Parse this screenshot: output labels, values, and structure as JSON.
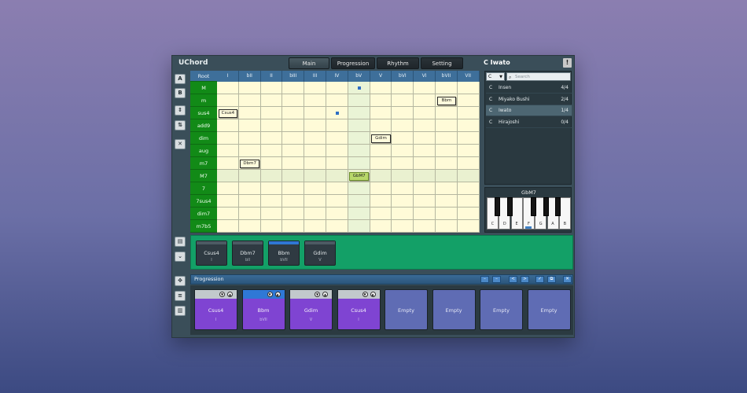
{
  "app": {
    "title": "UChord"
  },
  "tabs": [
    {
      "label": "Main",
      "active": true
    },
    {
      "label": "Progression",
      "active": false
    },
    {
      "label": "Rhythm",
      "active": false
    },
    {
      "label": "Setting",
      "active": false
    }
  ],
  "scale_title": "C Iwato",
  "alert_label": "!",
  "side_buttons": {
    "a": "A",
    "b": "B",
    "updown": "⇕",
    "sort": "⇅",
    "delete": "✕",
    "chart": "▤",
    "collapse": "⌄",
    "move": "✥",
    "list": "≡",
    "piano": "▥"
  },
  "grid": {
    "root_label": "Root",
    "columns": [
      "I",
      "bII",
      "II",
      "bIII",
      "III",
      "IV",
      "bV",
      "V",
      "bVI",
      "VI",
      "bVII",
      "VII"
    ],
    "rows": [
      "M",
      "m",
      "sus4",
      "add9",
      "dim",
      "aug",
      "m7",
      "M7",
      "7",
      "7sus4",
      "dim7",
      "m7b5"
    ],
    "chips": [
      {
        "label": "Csus4",
        "row": 2,
        "col": 0,
        "style": "plain"
      },
      {
        "label": "Bbm",
        "row": 1,
        "col": 10,
        "style": "plain"
      },
      {
        "label": "Gdim",
        "row": 4,
        "col": 7,
        "style": "plain"
      },
      {
        "label": "Dbm7",
        "row": 6,
        "col": 1,
        "style": "plain"
      },
      {
        "label": "GbM7",
        "row": 7,
        "col": 6,
        "style": "green"
      }
    ],
    "dots": [
      {
        "row": 0,
        "col": 6
      },
      {
        "row": 2,
        "col": 5
      }
    ]
  },
  "scale_panel": {
    "key_value": "C",
    "search_placeholder": "Search",
    "scales": [
      {
        "key": "C",
        "name": "Insen",
        "count": "4/4",
        "selected": false
      },
      {
        "key": "C",
        "name": "Miyako Bushi",
        "count": "2/4",
        "selected": false
      },
      {
        "key": "C",
        "name": "Iwato",
        "count": "1/4",
        "selected": true
      },
      {
        "key": "C",
        "name": "Hirajoshi",
        "count": "0/4",
        "selected": false
      }
    ]
  },
  "keyboard": {
    "title": "GbM7",
    "white_keys": [
      "C",
      "D",
      "E",
      "F",
      "G",
      "A",
      "B"
    ]
  },
  "strip": [
    {
      "name": "Csus4",
      "degree": "I",
      "selected": false
    },
    {
      "name": "Dbm7",
      "degree": "bII",
      "selected": false
    },
    {
      "name": "Bbm",
      "degree": "bVII",
      "selected": true
    },
    {
      "name": "Gdim",
      "degree": "V",
      "selected": false
    }
  ],
  "progression": {
    "title": "Progression",
    "buttons": [
      "–",
      "–",
      "<",
      ">",
      "✓",
      "⧉",
      "✕"
    ],
    "slots": [
      {
        "name": "Csus4",
        "degree": "I",
        "filled": true,
        "selected": false
      },
      {
        "name": "Bbm",
        "degree": "bVII",
        "filled": true,
        "selected": true
      },
      {
        "name": "Gdim",
        "degree": "V",
        "filled": true,
        "selected": false
      },
      {
        "name": "Csus4",
        "degree": "I",
        "filled": true,
        "selected": false
      },
      {
        "name": "Empty",
        "degree": "",
        "filled": false,
        "selected": false
      },
      {
        "name": "Empty",
        "degree": "",
        "filled": false,
        "selected": false
      },
      {
        "name": "Empty",
        "degree": "",
        "filled": false,
        "selected": false
      },
      {
        "name": "Empty",
        "degree": "",
        "filled": false,
        "selected": false
      }
    ]
  }
}
